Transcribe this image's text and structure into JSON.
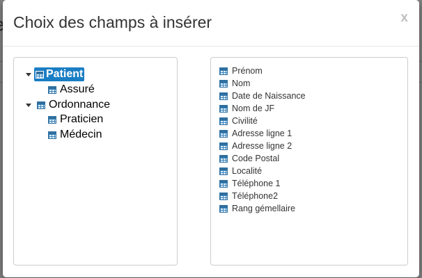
{
  "modal": {
    "title": "Choix des champs à insérer",
    "close_label": "x"
  },
  "tree": {
    "nodes": [
      {
        "label": "Patient",
        "selected": true,
        "expanded": true
      },
      {
        "label": "Assuré"
      },
      {
        "label": "Ordonnance",
        "expanded": true
      },
      {
        "label": "Praticien"
      },
      {
        "label": "Médecin"
      }
    ]
  },
  "fields": [
    "Prénom",
    "Nom",
    "Date de Naissance",
    "Nom de JF",
    "Civilité",
    "Adresse ligne 1",
    "Adresse ligne 2",
    "Code Postal",
    "Localité",
    "Téléphone 1",
    "Téléphone2",
    "Rang gémellaire"
  ],
  "colors": {
    "selected_bg": "#1a7ec4",
    "table_icon": "#3b83bb"
  },
  "icons": {
    "tree_toggle": "caret-down-icon",
    "node": "table-icon"
  }
}
